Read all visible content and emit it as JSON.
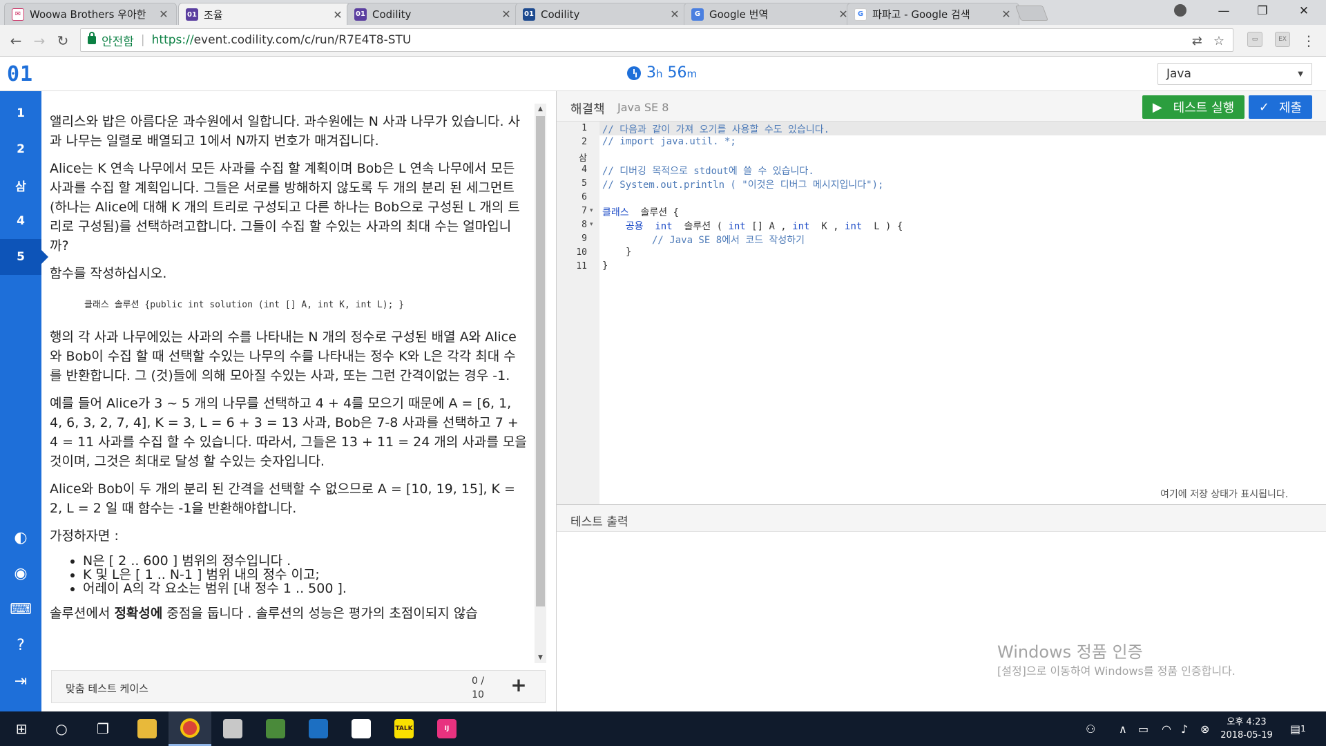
{
  "browser": {
    "tabs": [
      {
        "title": "Woowa Brothers 우아한",
        "favicon": "mail"
      },
      {
        "title": "조율",
        "favicon": "01"
      },
      {
        "title": "Codility",
        "favicon": "01"
      },
      {
        "title": "Codility",
        "favicon": "01"
      },
      {
        "title": "Google 번역",
        "favicon": "translate"
      },
      {
        "title": "파파고 - Google 검색",
        "favicon": "G"
      }
    ],
    "active_tab": 1,
    "secure_label": "안전함",
    "url_scheme": "https://",
    "url_rest": "event.codility.com/c/run/R7E4T8-STU"
  },
  "app": {
    "logo": "01",
    "timer_h": "3",
    "timer_h_unit": "h",
    "timer_m": "56",
    "timer_m_unit": "m",
    "language": "Java"
  },
  "nav": {
    "items": [
      "1",
      "2",
      "삼",
      "4",
      "5"
    ],
    "active": 4
  },
  "task": {
    "p1": "앨리스와 밥은 아름다운 과수원에서 일합니다. 과수원에는 N 사과 나무가 있습니다. 사과 나무는 일렬로 배열되고 1에서 N까지 번호가 매겨집니다.",
    "p2": "Alice는 K 연속 나무에서 모든 사과를 수집 할 계획이며 Bob은 L 연속 나무에서 모든 사과를 수집 할 계획입니다. 그들은 서로를 방해하지 않도록 두 개의 분리 된 세그먼트 (하나는 Alice에 대해 K 개의 트리로 구성되고 다른 하나는 Bob으로 구성된 L 개의 트리로 구성됨)를 선택하려고합니다. 그들이 수집 할 수있는 사과의 최대 수는 얼마입니까?",
    "p3": "함수를 작성하십시오.",
    "code": "클래스 솔루션 {public int solution (int [] A, int K, int L); }",
    "p4": "행의 각 사과 나무에있는 사과의 수를 나타내는 N 개의 정수로 구성된 배열 A와 Alice와 Bob이 수집 할 때 선택할 수있는 나무의 수를 나타내는 정수 K와 L은 각각 최대 수를 반환합니다. 그 (것)들에 의해 모아질 수있는 사과, 또는 그런 간격이없는 경우 -1.",
    "p5": "예를 들어 Alice가 3 ~ 5 개의 나무를 선택하고 4 + 4를 모으기 때문에 A = [6, 1, 4, 6, 3, 2, 7, 4], K = 3, L = 6 + 3 = 13 사과, Bob은 7-8 사과를 선택하고 7 + 4 = 11 사과를 수집 할 수 있습니다. 따라서, 그들은 13 + 11 = 24 개의 사과를 모을 것이며, 그것은 최대로 달성 할 수있는 숫자입니다.",
    "p6": "Alice와 Bob이 두 개의 분리 된 간격을 선택할 수 없으므로 A = [10, 19, 15], K = 2, L = 2 일 때 함수는 -1을 반환해야합니다.",
    "p7": "가정하자면 :",
    "bullets": [
      "N은 [ 2 .. 600 ] 범위의 정수입니다 .",
      "K 및 L은 [ 1 .. N-1 ] 범위 내의 정수 이고;",
      "어레이 A의 각 요소는 범위 [내 정수 1 .. 500 ]."
    ],
    "p8_pre": "솔루션에서 ",
    "p8_bold": "정확성에",
    "p8_post": " 중점을 둡니다 . 솔루션의 성능은 평가의 초점이되지 않습"
  },
  "custom_tests": {
    "label": "맞춤 테스트 케이스",
    "count_top": "0 /",
    "count_bottom": "10",
    "add": "+"
  },
  "editor": {
    "title": "해결책",
    "subtitle": "Java SE 8",
    "run_label": "테스트 실행",
    "submit_label": "제출",
    "line_numbers": [
      "1",
      "2",
      "삼",
      "4",
      "5",
      "6",
      "7",
      "8",
      "9",
      "10",
      "11"
    ],
    "status": "여기에 저장 상태가 표시됩니다.",
    "output_title": "테스트 출력"
  },
  "code_lines": {
    "l1": "// 다음과 같이 가져 오기를 사용할 수도 있습니다.",
    "l2": "// import java.util. *;",
    "l4": "// 디버깅 목적으로 stdout에 쓸 수 있습니다.",
    "l5a": "// System.out.println ( \"이것은 디버그 메시지입니다\");",
    "l7a": "클래스",
    "l7b": "  솔루션 {",
    "l8a": "공용",
    "l8b": "int",
    "l8c": "  솔루션 ( ",
    "l8d": "int",
    "l8e": " [] A , ",
    "l8f": "int",
    "l8g": "  K , ",
    "l8h": "int",
    "l8i": "  L ) {",
    "l9": "// Java SE 8에서 코드 작성하기",
    "l10": "}",
    "l11": "}"
  },
  "watermark": {
    "line1": "Windows 정품 인증",
    "line2": "[설정]으로 이동하여 Windows를 정품 인증합니다."
  },
  "taskbar": {
    "ampm": "오후 4:23",
    "date": "2018-05-19",
    "notif": "1"
  }
}
